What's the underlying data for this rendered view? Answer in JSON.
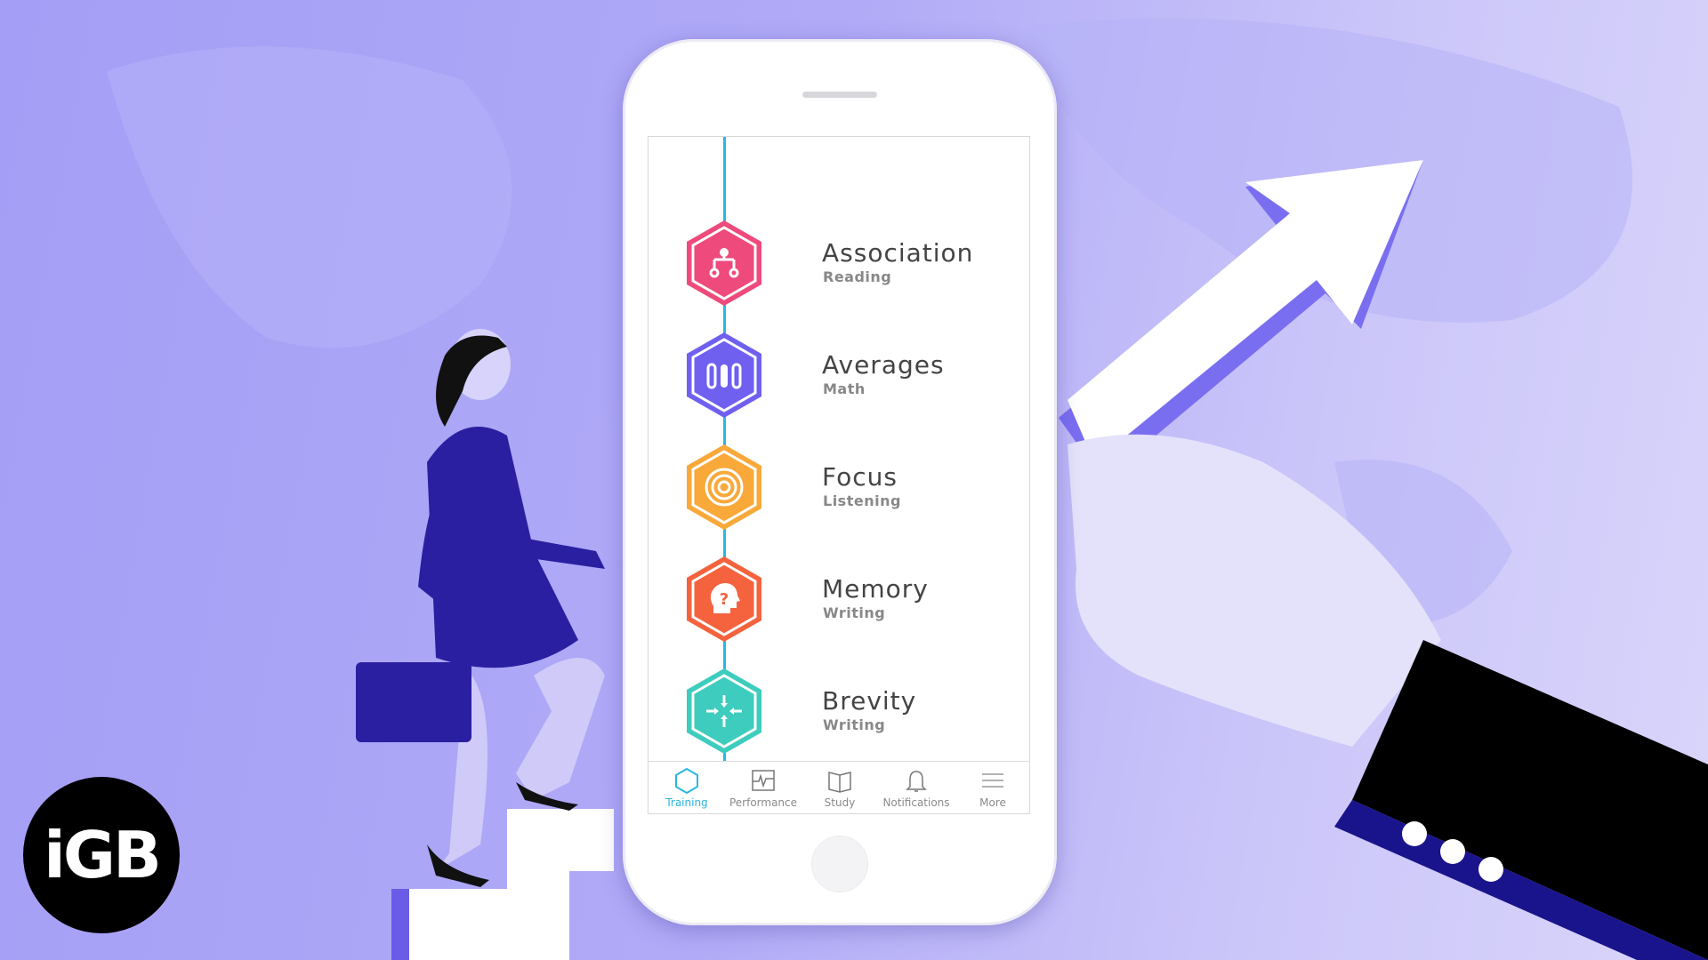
{
  "logo": {
    "text": "iGB"
  },
  "colors": {
    "accent": "#2bb6e0",
    "association": "#ee4a7c",
    "averages": "#7060f0",
    "focus": "#f8a93a",
    "memory": "#f4633d",
    "brevity": "#3dccbd"
  },
  "training_items": [
    {
      "title": "Association",
      "subtitle": "Reading",
      "icon": "branch-icon",
      "color": "#ee4a7c"
    },
    {
      "title": "Averages",
      "subtitle": "Math",
      "icon": "bars-icon",
      "color": "#7060f0"
    },
    {
      "title": "Focus",
      "subtitle": "Listening",
      "icon": "target-icon",
      "color": "#f8a93a"
    },
    {
      "title": "Memory",
      "subtitle": "Writing",
      "icon": "head-question-icon",
      "color": "#f4633d"
    },
    {
      "title": "Brevity",
      "subtitle": "Writing",
      "icon": "compress-arrows-icon",
      "color": "#3dccbd"
    }
  ],
  "tabs": [
    {
      "label": "Training",
      "icon": "hexagon-icon",
      "active": true
    },
    {
      "label": "Performance",
      "icon": "pulse-chart-icon"
    },
    {
      "label": "Study",
      "icon": "book-icon"
    },
    {
      "label": "Notifications",
      "icon": "bell-icon"
    },
    {
      "label": "More",
      "icon": "menu-icon"
    }
  ]
}
